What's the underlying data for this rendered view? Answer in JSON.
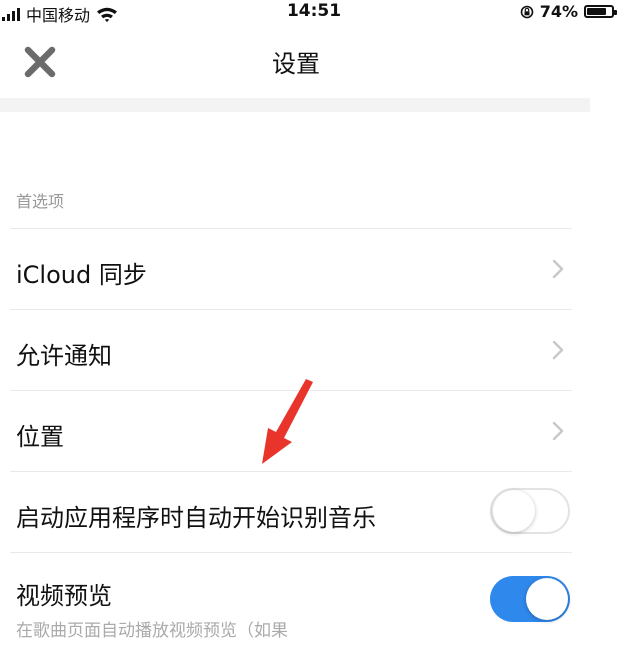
{
  "status_bar": {
    "carrier": "中国移动",
    "time": "14:51",
    "battery_percent": "74%",
    "battery_level": 0.74
  },
  "nav": {
    "title": "设置",
    "close_icon": "close-icon"
  },
  "preferences": {
    "header": "首选项",
    "items": [
      {
        "label": "iCloud 同步",
        "type": "disclosure"
      },
      {
        "label": "允许通知",
        "type": "disclosure"
      },
      {
        "label": "位置",
        "type": "disclosure"
      },
      {
        "label": "启动应用程序时自动开始识别音乐",
        "type": "toggle",
        "on": false
      },
      {
        "label": "视频预览",
        "type": "toggle",
        "on": true,
        "subtitle": "在歌曲页面自动播放视频预览（如果"
      }
    ]
  },
  "colors": {
    "accent": "#2f88ec",
    "annotation_arrow": "#e8342b"
  }
}
